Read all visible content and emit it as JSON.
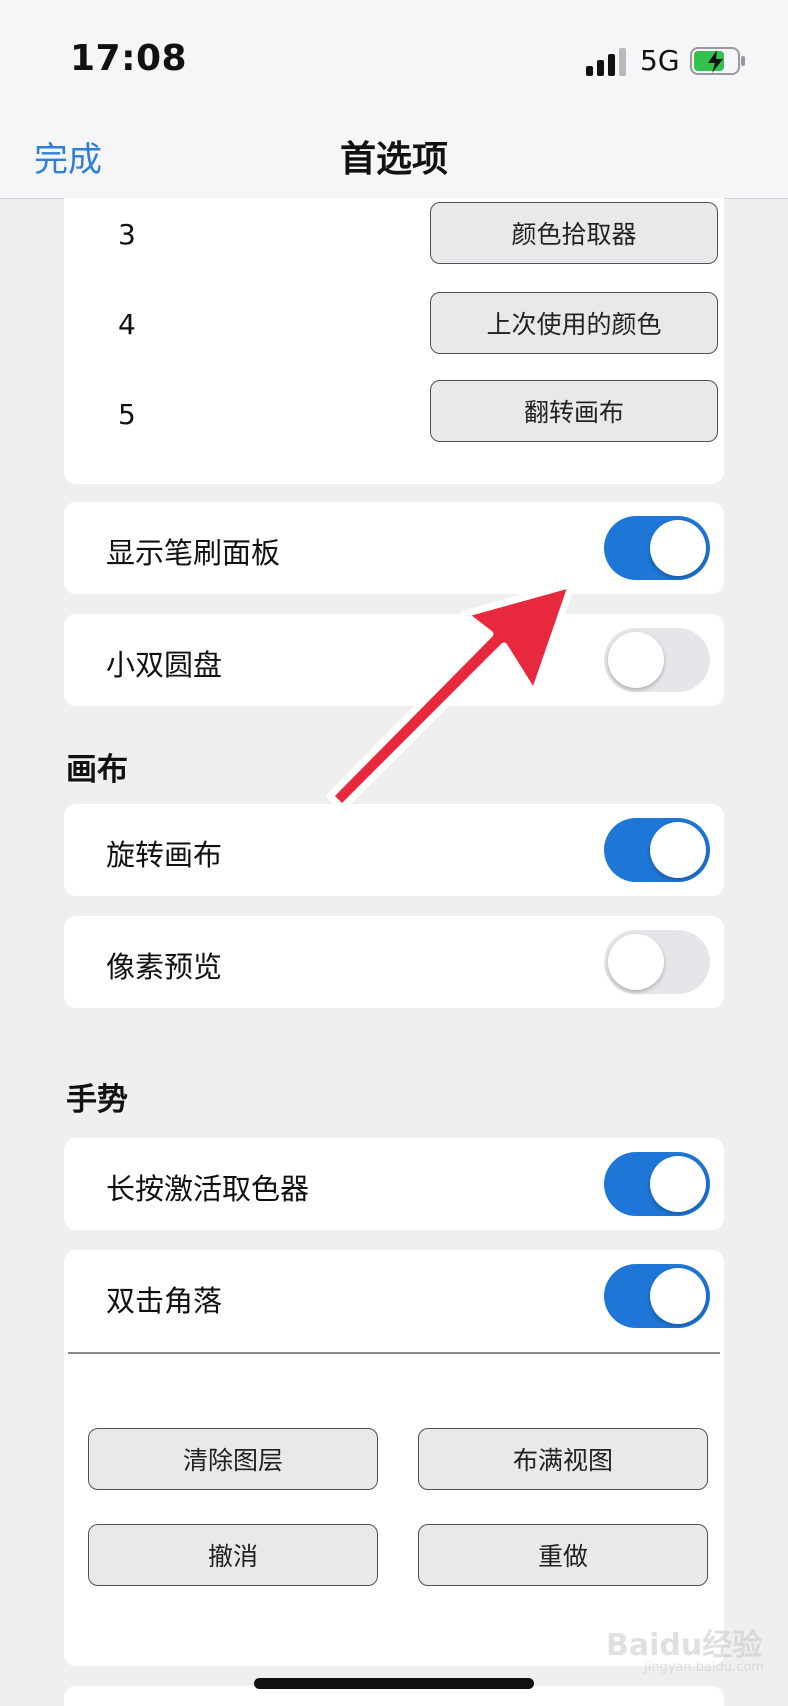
{
  "status_bar": {
    "time": "17:08",
    "network": "5G"
  },
  "nav": {
    "done_label": "完成",
    "title": "首选项"
  },
  "shortcuts": [
    {
      "number": "3",
      "action": "颜色拾取器"
    },
    {
      "number": "4",
      "action": "上次使用的颜色"
    },
    {
      "number": "5",
      "action": "翻转画布"
    }
  ],
  "settings": {
    "show_brush_panel": {
      "label": "显示笔刷面板",
      "on": true
    },
    "small_dual_disc": {
      "label": "小双圆盘",
      "on": false
    }
  },
  "canvas": {
    "title": "画布",
    "rotate_canvas": {
      "label": "旋转画布",
      "on": true
    },
    "pixel_preview": {
      "label": "像素预览",
      "on": false
    }
  },
  "gestures": {
    "title": "手势",
    "long_press_picker": {
      "label": "长按激活取色器",
      "on": true
    },
    "double_tap_corner": {
      "label": "双击角落",
      "on": true
    },
    "corner_actions": [
      "清除图层",
      "布满视图",
      "撤消",
      "重做"
    ]
  },
  "watermark": {
    "text": "Baidu经验",
    "url": "jingyan.baidu.com"
  },
  "colors": {
    "accent": "#1e76d6",
    "link": "#2f7fd8",
    "arrow": "#e8283c"
  }
}
